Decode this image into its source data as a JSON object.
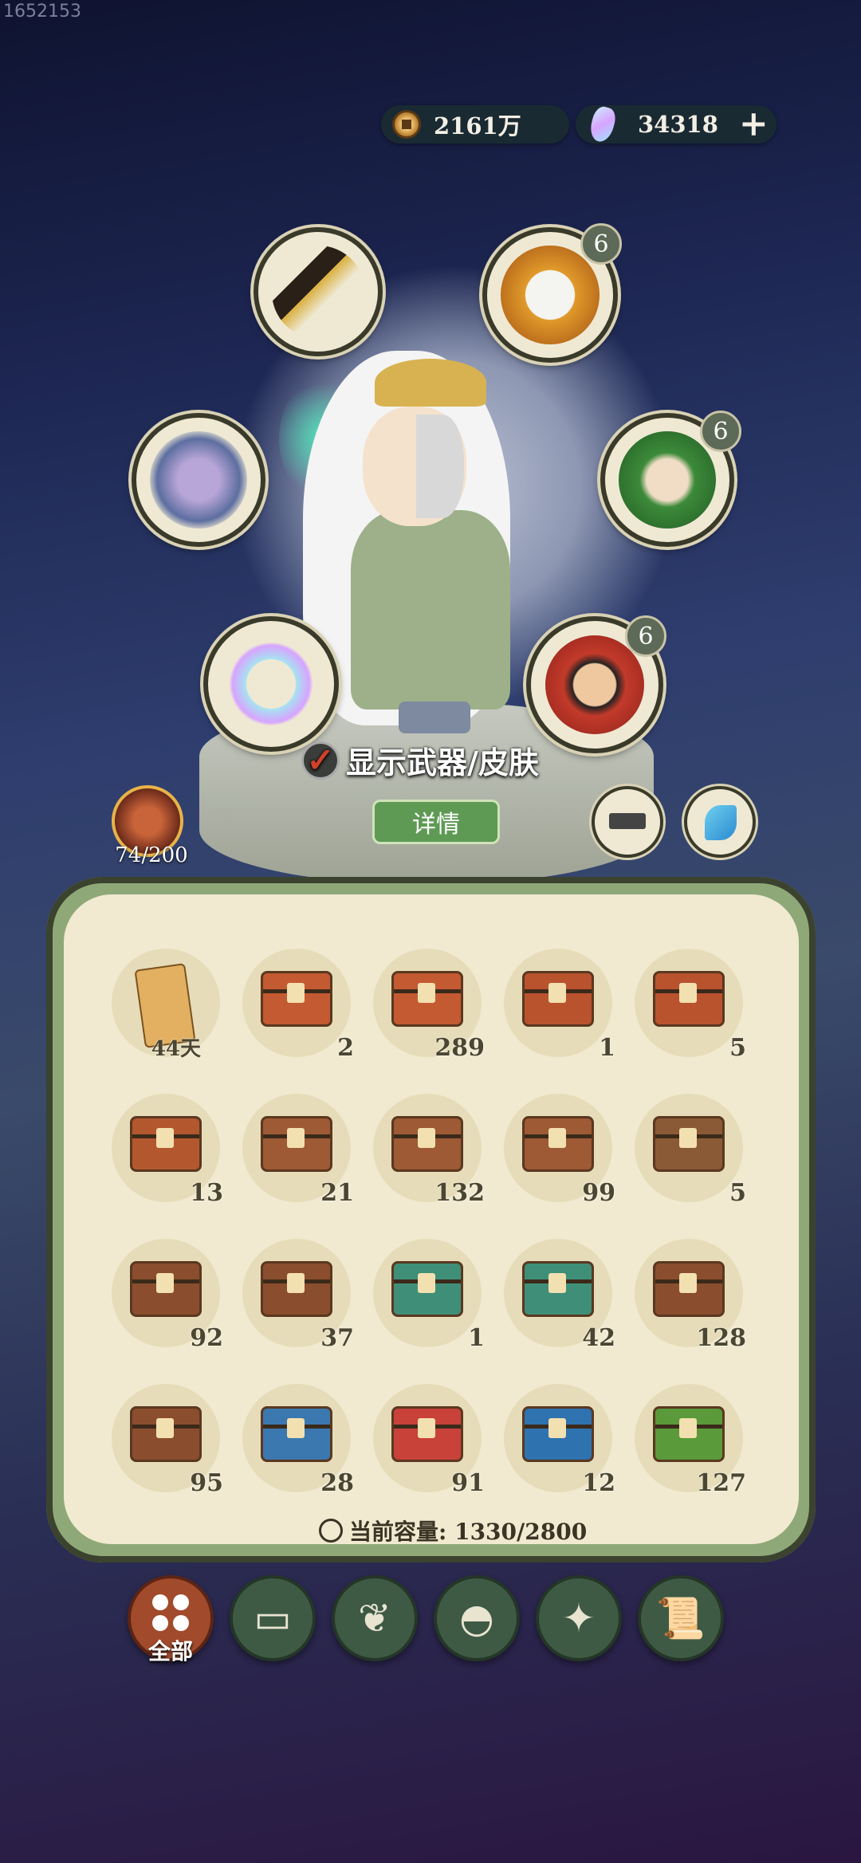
{
  "screen_id": "1652153",
  "currency": {
    "coins": "2161万",
    "gems": "34318"
  },
  "equip_slots": {
    "weapon_icon": "dagger-icon",
    "companion1": {
      "icon": "white-hair-companion-icon",
      "level": "6"
    },
    "armor_icon": "armor-icon",
    "companion2": {
      "icon": "flower-companion-icon",
      "level": "6"
    },
    "ring_icon": "ring-icon",
    "companion3": {
      "icon": "warrior-companion-icon",
      "level": "6"
    }
  },
  "hero": {
    "toggle_label": "显示武器/皮肤",
    "details_label": "详情"
  },
  "stamina": {
    "value": "74/200"
  },
  "inventory": {
    "items": [
      {
        "count": "44天",
        "kind": "scroll",
        "color": "#e2b060"
      },
      {
        "count": "2",
        "kind": "chest",
        "color": "#c45a32"
      },
      {
        "count": "289",
        "kind": "chest",
        "color": "#c45a32"
      },
      {
        "count": "1",
        "kind": "chest",
        "color": "#b9532e"
      },
      {
        "count": "5",
        "kind": "chest",
        "color": "#b9532e"
      },
      {
        "count": "13",
        "kind": "chest",
        "color": "#b3582e"
      },
      {
        "count": "21",
        "kind": "chest",
        "color": "#9d5a34"
      },
      {
        "count": "132",
        "kind": "chest",
        "color": "#9d5a34"
      },
      {
        "count": "99",
        "kind": "chest",
        "color": "#9d5a34"
      },
      {
        "count": "5",
        "kind": "chest",
        "color": "#8a5a36"
      },
      {
        "count": "92",
        "kind": "chest",
        "color": "#8a4e2e"
      },
      {
        "count": "37",
        "kind": "chest",
        "color": "#8a4e2e"
      },
      {
        "count": "1",
        "kind": "chest",
        "color": "#3f8f78"
      },
      {
        "count": "42",
        "kind": "chest",
        "color": "#3f8f78"
      },
      {
        "count": "128",
        "kind": "chest",
        "color": "#8a4e2e"
      },
      {
        "count": "95",
        "kind": "chest",
        "color": "#8a4e2e"
      },
      {
        "count": "28",
        "kind": "chest",
        "color": "#3c78b0"
      },
      {
        "count": "91",
        "kind": "chest",
        "color": "#c8423a"
      },
      {
        "count": "12",
        "kind": "chest",
        "color": "#2e72b0"
      },
      {
        "count": "127",
        "kind": "chest",
        "color": "#5a9a3a"
      }
    ],
    "capacity_label": "当前容量: 1330/2800"
  },
  "tabs": [
    {
      "name": "all",
      "label": "全部",
      "icon": "grid-icon",
      "active": true
    },
    {
      "name": "wood",
      "label": "",
      "icon": "log-icon",
      "glyph": "▭"
    },
    {
      "name": "herb",
      "label": "",
      "icon": "leaf-icon",
      "glyph": "❦"
    },
    {
      "name": "food",
      "label": "",
      "icon": "rice-bowl-icon",
      "glyph": "◓"
    },
    {
      "name": "ore",
      "label": "",
      "icon": "ore-icon",
      "glyph": "✦"
    },
    {
      "name": "scroll",
      "label": "",
      "icon": "scroll-icon",
      "glyph": "📜"
    }
  ]
}
